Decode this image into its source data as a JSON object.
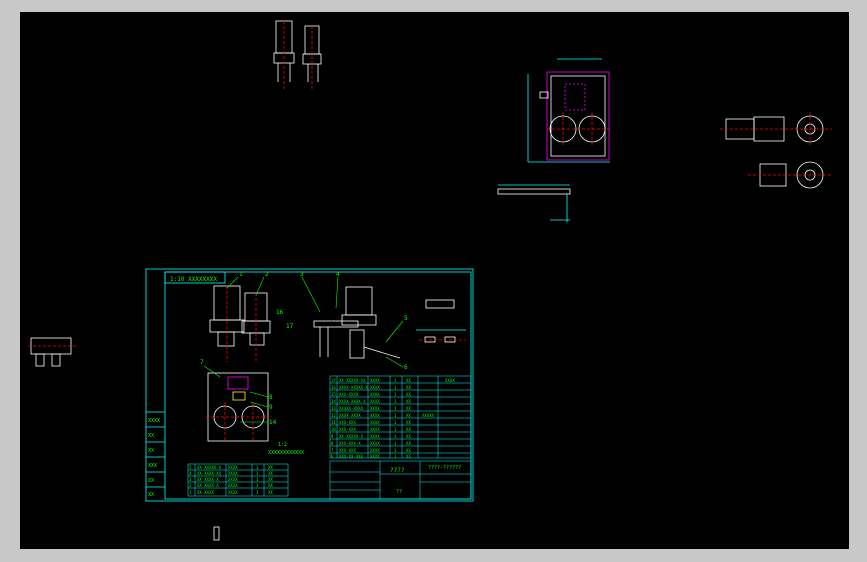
{
  "drawing": {
    "title_label": "1:10 XXXXXXXX",
    "subtitle": "XXXXXXXXXXXX",
    "scale_note": "1:2",
    "project_name": "????",
    "drawing_no": "????-??????",
    "sheet_no": "??",
    "callouts": [
      "1",
      "2",
      "3",
      "4",
      "5",
      "6",
      "7",
      "8",
      "9",
      "10",
      "11",
      "12",
      "13",
      "14",
      "15",
      "16",
      "17"
    ],
    "bom_rows": [
      [
        "17",
        "XX-XXXXX-XX",
        "XXXX",
        "1",
        "XX",
        "XXXX"
      ],
      [
        "16",
        "XXXX-XXXXX-X",
        "XXXX",
        "1",
        "XX",
        ""
      ],
      [
        "15",
        "XXX-XXXX",
        "XXXX",
        "1",
        "XX",
        ""
      ],
      [
        "14",
        "XXXX-XXXX-X",
        "XXXX",
        "1",
        "XX",
        ""
      ],
      [
        "13",
        "XXXXX-XXXX",
        "XXXX",
        "1",
        "XX",
        ""
      ],
      [
        "12",
        "XXXX-XXXX",
        "XXXX",
        "1",
        "XX",
        "XXXXX"
      ],
      [
        "11",
        "XXX-XXX",
        "XXXX",
        "1",
        "XX",
        ""
      ],
      [
        "10",
        "XXX-XXX",
        "XXXX",
        "1",
        "XX",
        ""
      ],
      [
        "9",
        "XX-XXXXX-X",
        "XXXX",
        "1",
        "XX",
        ""
      ],
      [
        "8",
        "XXX-XXX-X",
        "XXXX",
        "1",
        "XX",
        ""
      ],
      [
        "7",
        "XXX-XXX",
        "XXXX",
        "1",
        "XX",
        ""
      ],
      [
        "6",
        "XXX-XX-XXX",
        "XXXX",
        "1",
        "XX",
        ""
      ]
    ],
    "bom_rows_left": [
      [
        "5",
        "XX-XXXXX-X",
        "XXXX",
        "1",
        "XX"
      ],
      [
        "4",
        "XX-XXXX-XX",
        "XXXX",
        "1",
        "XX"
      ],
      [
        "3",
        "XX-XXXX-X",
        "XXXX",
        "1",
        "XX"
      ],
      [
        "2",
        "XX-XXXX-X",
        "XXXX",
        "1",
        "XX"
      ],
      [
        "1",
        "XX-XXXX",
        "XXXX",
        "1",
        "XX"
      ]
    ],
    "side_labels": [
      "XXXX",
      "XX",
      "XX",
      "XXX",
      "XX",
      "XX"
    ]
  },
  "colors": {
    "background": "#000000",
    "outer": "#c8c8c8",
    "lines": "#ffffff",
    "frame": "#00ffff",
    "text": "#00ff00",
    "dim": "#00ffff",
    "highlight": "#ff00ff",
    "red": "#ff0000",
    "yellow": "#ffff00"
  }
}
